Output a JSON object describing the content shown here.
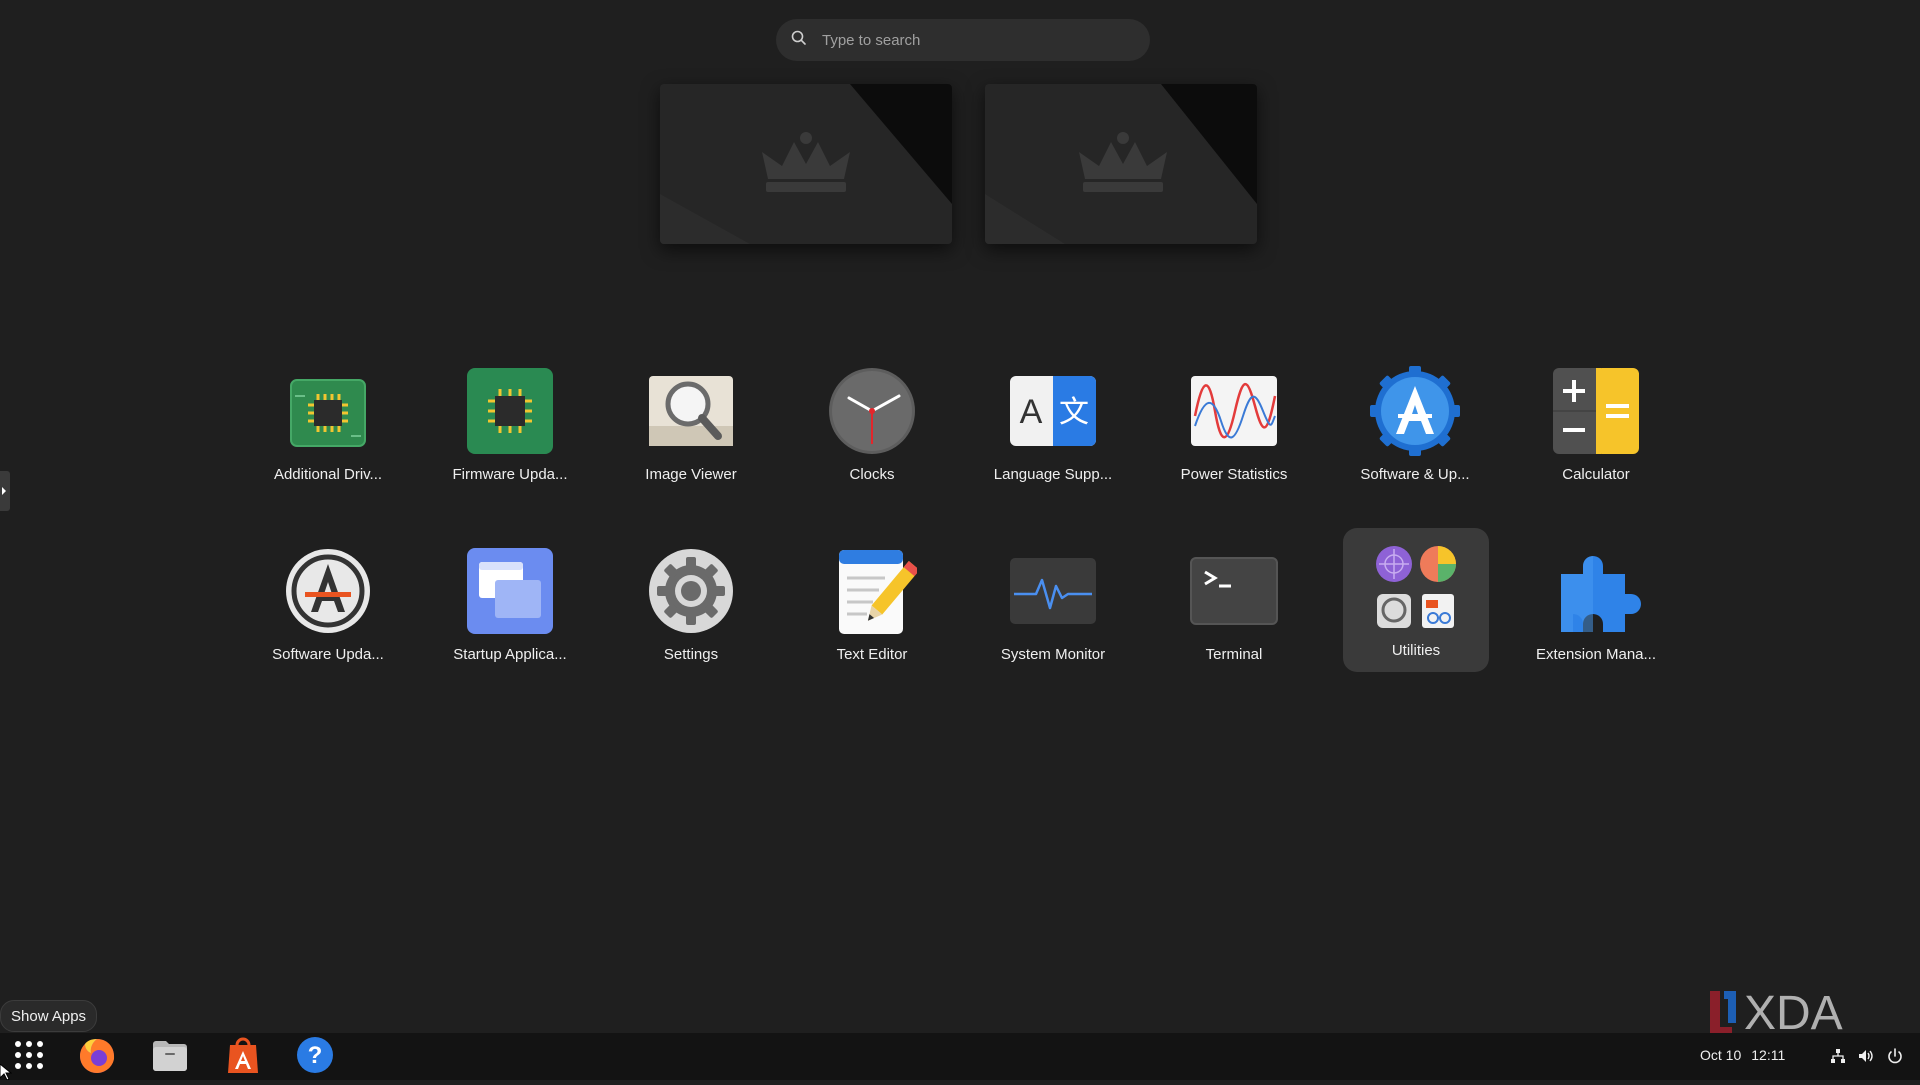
{
  "search": {
    "placeholder": "Type to search",
    "icon": "search-icon"
  },
  "workspaces": [
    {
      "name": "workspace-1",
      "wallpaper": "crown-on-dark-wallpaper"
    },
    {
      "name": "workspace-2",
      "wallpaper": "crown-on-dark-wallpaper"
    }
  ],
  "apps": [
    {
      "key": "additional-drivers",
      "label": "Additional Driv...",
      "icon": "chip-icon"
    },
    {
      "key": "firmware-updater",
      "label": "Firmware Upda...",
      "icon": "firmware-chip-icon"
    },
    {
      "key": "image-viewer",
      "label": "Image Viewer",
      "icon": "magnifier-icon"
    },
    {
      "key": "clocks",
      "label": "Clocks",
      "icon": "clock-icon"
    },
    {
      "key": "language-support",
      "label": "Language Supp...",
      "icon": "language-icon"
    },
    {
      "key": "power-statistics",
      "label": "Power Statistics",
      "icon": "graph-icon"
    },
    {
      "key": "software-updates",
      "label": "Software & Up...",
      "icon": "software-sources-icon"
    },
    {
      "key": "calculator",
      "label": "Calculator",
      "icon": "calculator-icon"
    },
    {
      "key": "software-updater",
      "label": "Software Upda...",
      "icon": "software-updater-icon"
    },
    {
      "key": "startup-applications",
      "label": "Startup Applica...",
      "icon": "startup-window-icon"
    },
    {
      "key": "settings",
      "label": "Settings",
      "icon": "gear-icon"
    },
    {
      "key": "text-editor",
      "label": "Text Editor",
      "icon": "notepad-pencil-icon"
    },
    {
      "key": "system-monitor",
      "label": "System Monitor",
      "icon": "pulse-icon"
    },
    {
      "key": "terminal",
      "label": "Terminal",
      "icon": "terminal-icon"
    },
    {
      "key": "utilities",
      "label": "Utilities",
      "icon": "folder-grid-icon"
    },
    {
      "key": "extension-manager",
      "label": "Extension Mana...",
      "icon": "puzzle-icon"
    }
  ],
  "tooltip": "Show Apps",
  "dock": {
    "items": [
      {
        "key": "show-apps",
        "icon": "grid-dots-icon"
      },
      {
        "key": "firefox",
        "icon": "firefox-icon"
      },
      {
        "key": "files",
        "icon": "files-icon"
      },
      {
        "key": "app-center",
        "icon": "app-center-icon"
      },
      {
        "key": "help",
        "icon": "help-icon"
      }
    ]
  },
  "topbar": {
    "date": "Oct 10",
    "time": "12:11",
    "tray": [
      "network-icon",
      "volume-icon",
      "power-icon"
    ]
  },
  "watermark": "XDA",
  "colors": {
    "background": "#1f1f1f",
    "dock": "#131313",
    "hover": "#3a3a3a",
    "accent_blue": "#2a7be4",
    "accent_orange": "#e95420"
  }
}
